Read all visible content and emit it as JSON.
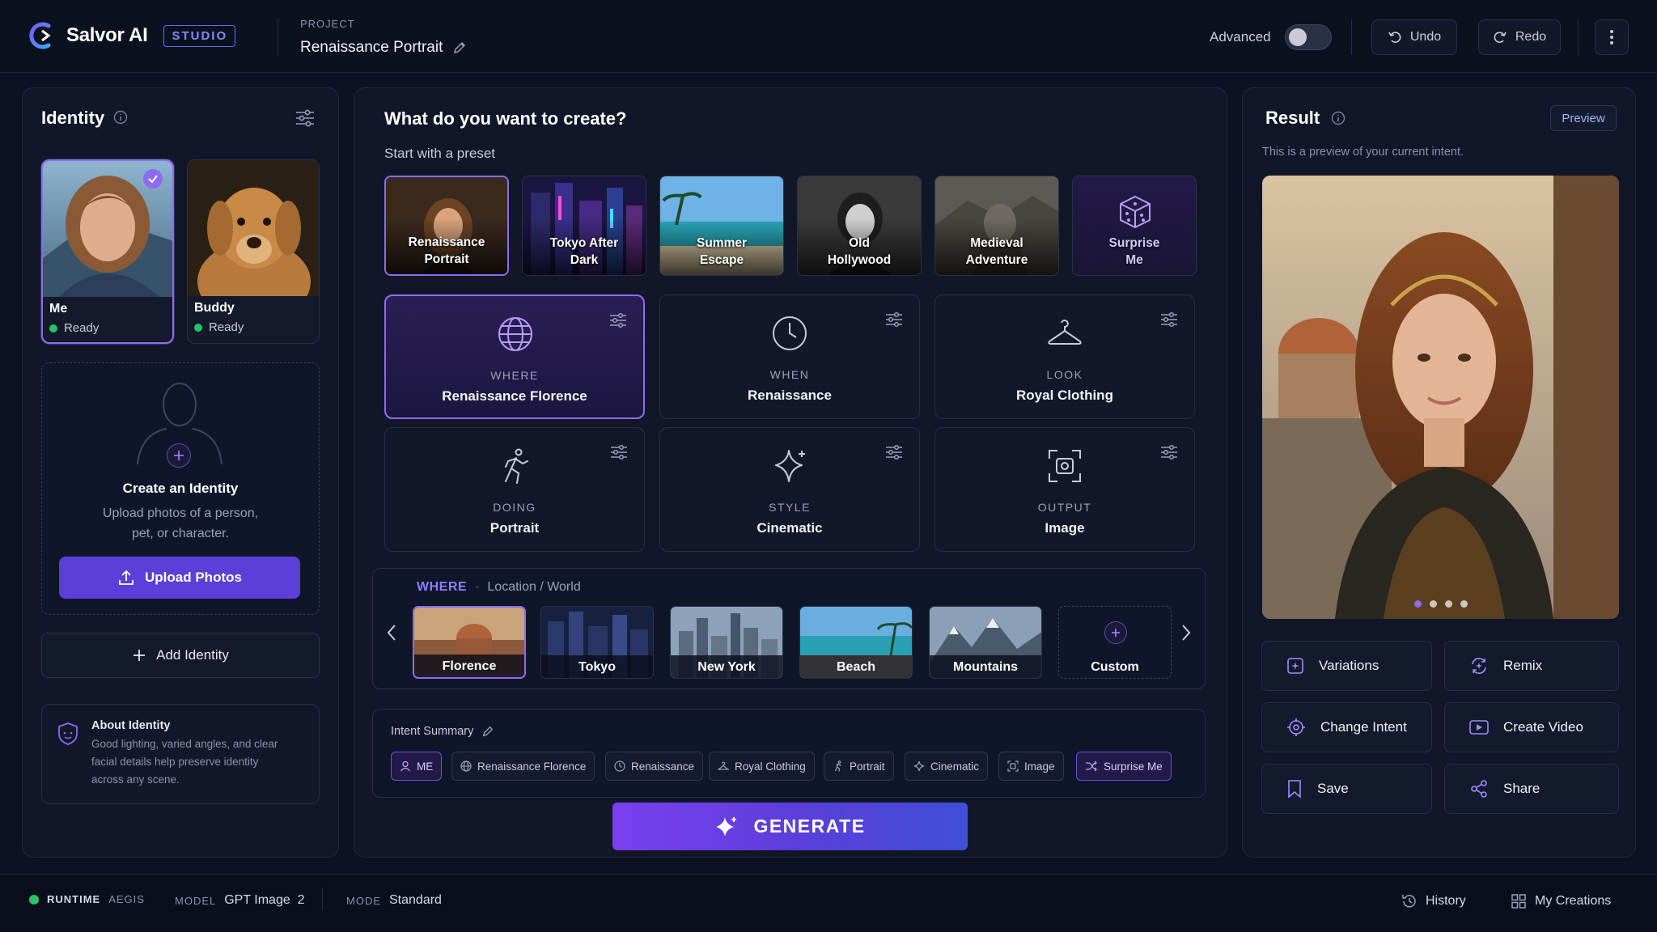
{
  "app": {
    "name": "Salvor AI",
    "badge": "STUDIO"
  },
  "project": {
    "label": "PROJECT",
    "name": "Renaissance Portrait"
  },
  "topbar": {
    "advanced_label": "Advanced",
    "advanced_on": false,
    "undo": "Undo",
    "redo": "Redo"
  },
  "identity": {
    "title": "Identity",
    "cards": [
      {
        "name": "Me",
        "status": "Ready",
        "selected": true
      },
      {
        "name": "Buddy",
        "status": "Ready",
        "selected": false
      }
    ],
    "create": {
      "title": "Create an Identity",
      "desc_line1": "Upload photos of a person,",
      "desc_line2": "pet, or character.",
      "upload": "Upload Photos"
    },
    "add": "Add Identity",
    "about": {
      "title": "About Identity",
      "line1": "Good lighting, varied angles, and clear",
      "line2": "facial details help preserve identity",
      "line3": "across any scene."
    }
  },
  "create": {
    "title": "What do you want to create?",
    "preset_label": "Start with a preset",
    "presets": [
      {
        "l1": "Renaissance",
        "l2": "Portrait",
        "selected": true
      },
      {
        "l1": "Tokyo After",
        "l2": "Dark"
      },
      {
        "l1": "Summer",
        "l2": "Escape"
      },
      {
        "l1": "Old",
        "l2": "Hollywood"
      },
      {
        "l1": "Medieval",
        "l2": "Adventure"
      },
      {
        "l1": "Surprise",
        "l2": "Me",
        "icon": "dice-icon"
      }
    ],
    "intents": [
      {
        "cat": "WHERE",
        "val": "Renaissance Florence",
        "icon": "globe-icon",
        "selected": true
      },
      {
        "cat": "WHEN",
        "val": "Renaissance",
        "icon": "clock-icon"
      },
      {
        "cat": "LOOK",
        "val": "Royal Clothing",
        "icon": "hanger-icon"
      },
      {
        "cat": "DOING",
        "val": "Portrait",
        "icon": "running-icon"
      },
      {
        "cat": "STYLE",
        "val": "Cinematic",
        "icon": "sparkle-icon"
      },
      {
        "cat": "OUTPUT",
        "val": "Image",
        "icon": "image-frame-icon"
      }
    ],
    "where": {
      "label": "WHERE",
      "sub": "Location / World",
      "options": [
        "Florence",
        "Tokyo",
        "New York",
        "Beach",
        "Mountains",
        "Custom"
      ]
    },
    "summary": {
      "label": "Intent Summary",
      "chips": [
        "ME",
        "Renaissance Florence",
        "Renaissance",
        "Royal Clothing",
        "Portrait",
        "Cinematic",
        "Image",
        "Surprise Me"
      ]
    },
    "generate": "GENERATE"
  },
  "result": {
    "title": "Result",
    "preview_btn": "Preview",
    "desc": "This is a preview of your current intent.",
    "carousel": {
      "count": 4,
      "active": 1
    },
    "actions": [
      "Variations",
      "Remix",
      "Change Intent",
      "Create Video",
      "Save",
      "Share"
    ]
  },
  "status": {
    "runtime_label": "RUNTIME",
    "runtime_value": "AEGIS",
    "model_label": "MODEL",
    "model_value": "GPT Image  2",
    "mode_label": "MODE",
    "mode_value": "Standard",
    "history": "History",
    "creations": "My Creations"
  },
  "colors": {
    "accent": "#8c6cf2",
    "primary": "#5b3fd8",
    "ready": "#27c36a",
    "bg": "#0d1222"
  }
}
